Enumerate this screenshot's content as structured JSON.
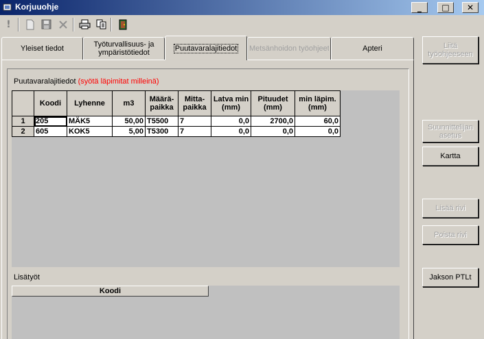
{
  "window": {
    "title": "Korjuuohje"
  },
  "caption_buttons": {
    "minimize": "_",
    "maximize": "□",
    "close": "✕"
  },
  "tabs": [
    {
      "label": "Yleiset tiedot",
      "state": "normal"
    },
    {
      "label": "Työturvallisuus- ja ympäristötiedot",
      "state": "normal"
    },
    {
      "label": "Puutavaralajitiedot",
      "state": "active"
    },
    {
      "label": "Metsänhoidon työohjeet",
      "state": "disabled"
    },
    {
      "label": "Apteri",
      "state": "normal"
    }
  ],
  "puutavara": {
    "title": "Puutavaralajitiedot",
    "note": "(syötä läpimitat milleinä)",
    "note_color": "#ff0000",
    "columns": [
      "",
      "Koodi",
      "Lyhenne",
      "m3",
      "Määrä-paikka",
      "Mitta-paikka",
      "Latva min (mm)",
      "Pituudet (mm)",
      "min läpim. (mm)"
    ],
    "rows": [
      {
        "n": "1",
        "koodi": "205",
        "lyhenne": "MÄK5",
        "m3": "50,00",
        "maara": "T5500",
        "mitta": "7",
        "latva": "0,0",
        "pituudet": "2700,0",
        "minlapim": "60,0"
      },
      {
        "n": "2",
        "koodi": "605",
        "lyhenne": "KOK5",
        "m3": "5,00",
        "maara": "T5300",
        "mitta": "7",
        "latva": "0,0",
        "pituudet": "0,0",
        "minlapim": "0,0"
      }
    ]
  },
  "lisatyot": {
    "title": "Lisätyöt",
    "columns": [
      "Koodi"
    ]
  },
  "side_buttons": {
    "liita": "Liitä työohjeeseen",
    "suunnittelija": "Suunnittelijan asetus",
    "kartta": "Kartta",
    "lisaa_rivi": "Lisää rivi",
    "poista_rivi": "Poista rivi",
    "jakson": "Jakson PTLt"
  },
  "toolbar": {
    "icons": [
      "exclamation-icon",
      "new-document-icon",
      "save-icon",
      "delete-icon",
      "print-icon",
      "copy-icon",
      "exit-door-icon"
    ]
  }
}
